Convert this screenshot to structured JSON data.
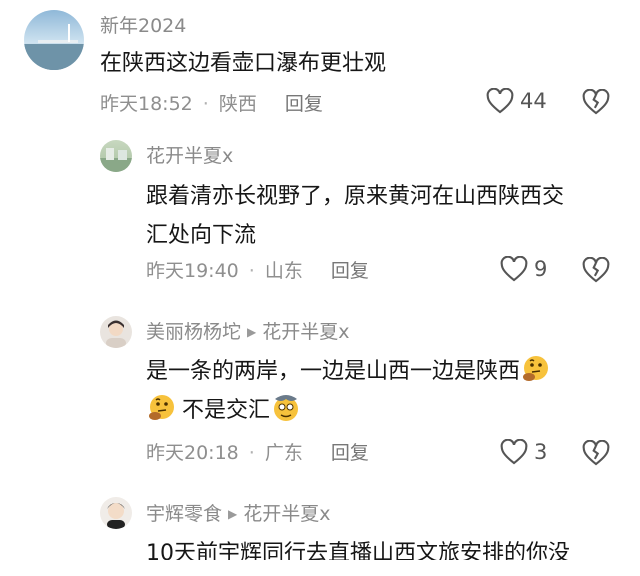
{
  "comments": [
    {
      "username": "新年2024",
      "lines": [
        "在陕西这边看壶口瀑布更壮观"
      ],
      "time": "昨天18:52",
      "location": "陕西",
      "reply_label": "回复",
      "likes": "44"
    },
    {
      "username": "花开半夏x",
      "lines": [
        "跟着清亦长视野了，原来黄河在山西陕西交",
        "汇处向下流"
      ],
      "time": "昨天19:40",
      "location": "山东",
      "reply_label": "回复",
      "likes": "9"
    },
    {
      "username": "美丽杨杨坨",
      "reply_to": "花开半夏x",
      "line1": "是一条的两岸，一边是山西一边是陕西",
      "line2": "不是交汇",
      "time": "昨天20:18",
      "location": "广东",
      "reply_label": "回复",
      "likes": "3"
    },
    {
      "username": "宇辉零食",
      "reply_to": "花开半夏x",
      "lines": [
        "10天前宇辉同行去直播山西文旅安排的你没"
      ]
    }
  ],
  "icons": {
    "like": "heart-outline-icon",
    "dislike": "broken-heart-icon",
    "reply_arrow": "reply-arrow-icon",
    "emoji": "thinking-face-emoji"
  }
}
